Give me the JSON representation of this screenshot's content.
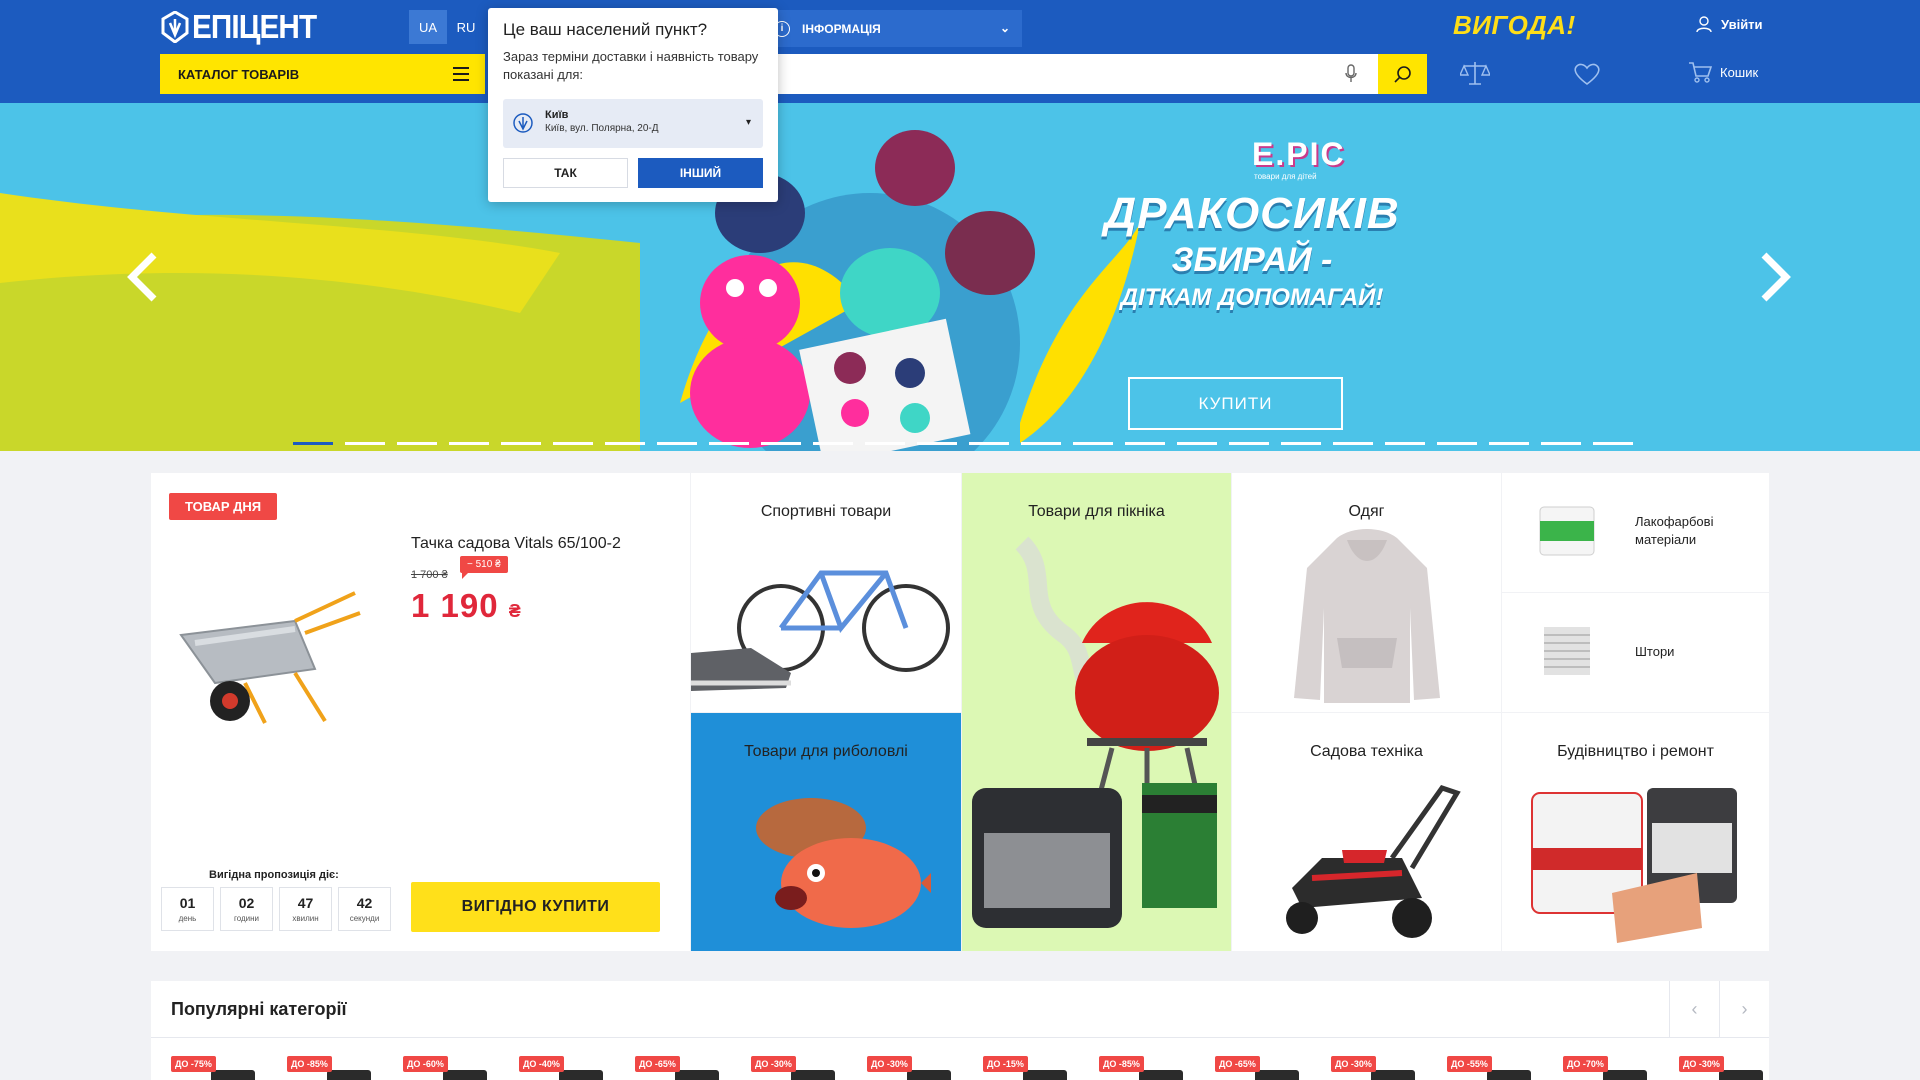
{
  "header": {
    "logo_text": "ЕПІЦЕНТ",
    "lang_ua": "UA",
    "lang_ru": "RU",
    "info_label": "ІНФОРМАЦІЯ",
    "vygoda": "ВИГОДА!",
    "login_label": "Увійти",
    "catalog_label": "КАТАЛОГ ТОВАРІВ",
    "search_placeholder": "",
    "cart_label": "Кошик",
    "brand_color": "#1c5bbf",
    "accent_color": "#ffe500"
  },
  "popup": {
    "title": "Це ваш населений пункт?",
    "text": "Зараз терміни доставки і наявність товару показані для:",
    "city": "Київ",
    "address": "Київ, вул. Полярна, 20-Д",
    "yes_label": "ТАК",
    "other_label": "ІНШИЙ"
  },
  "hero": {
    "brand": "E.PIC",
    "brand_sub": "товари для дітей",
    "title_l1": "ДРАКОСИКІВ",
    "title_l2": "ЗБИРАЙ -",
    "title_l3": "ДІТКАМ ДОПОМАГАЙ!",
    "button_label": "КУПИТИ",
    "slide_count": 26,
    "active_slide": 1
  },
  "deal": {
    "badge": "ТОВАР ДНЯ",
    "name": "Тачка садова Vitals 65/100-2",
    "old_price": "1 700 ₴",
    "discount": "− 510 ₴",
    "price": "1 190",
    "currency": "₴",
    "offer_label": "Вигідна пропозиція діє:",
    "timer": [
      {
        "value": "01",
        "unit": "день"
      },
      {
        "value": "02",
        "unit": "години"
      },
      {
        "value": "47",
        "unit": "хвилин"
      },
      {
        "value": "42",
        "unit": "секунди"
      }
    ],
    "buy_label": "ВИГІДНО КУПИТИ"
  },
  "categories": {
    "sport": "Спортивні товари",
    "fishing": "Товари для риболовлі",
    "picnic": "Товари для пікніка",
    "clothes": "Одяг",
    "garden": "Садова техніка",
    "build": "Будівництво і ремонт",
    "paint": "Лакофарбові матеріали",
    "curtains": "Штори"
  },
  "popular": {
    "title": "Популярні категорії",
    "badges": [
      "ДО -75%",
      "ДО -85%",
      "ДО -60%",
      "ДО -40%",
      "ДО -65%",
      "ДО -30%",
      "ДО -30%",
      "ДО -15%",
      "ДО -85%",
      "ДО -65%",
      "ДО -30%",
      "ДО -55%",
      "ДО -70%",
      "ДО -30%"
    ]
  }
}
